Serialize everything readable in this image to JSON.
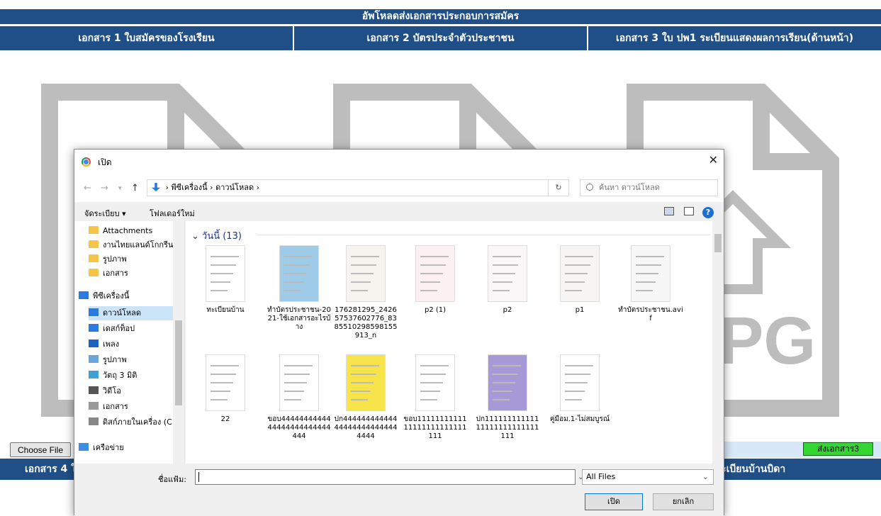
{
  "page": {
    "title": "อัพโหลดส่งเอกสารประกอบการสมัคร",
    "columns": [
      "เอกสาร 1 ใบสมัครของโรงเรียน",
      "เอกสาร 2 บัตรประจำตัวประชาชน",
      "เอกสาร 3 ใบ ปพ1 ระเบียนแสดงผลการเรียน(ด้านหน้า)"
    ],
    "choose_file": "Choose File",
    "send_button": "ส่งเอกสาร3",
    "bottom_left": "เอกสาร 4 ใ",
    "bottom_right": "าทะเบียนบ้านบิดา"
  },
  "dialog": {
    "title": "เปิด",
    "close": "✕",
    "breadcrumb": [
      "พีซีเครื่องนี้",
      "ดาวน์โหลด"
    ],
    "search_placeholder": "ค้นหา ดาวน์โหลด",
    "organize": "จัดระเบียบ ▾",
    "new_folder": "โฟลเดอร์ใหม่",
    "sidebar": [
      {
        "label": "Attachments",
        "icon": "folder-icon"
      },
      {
        "label": "งานไทยแลนด์โกกรีน",
        "icon": "folder-icon"
      },
      {
        "label": "รูปภาพ",
        "icon": "folder-icon"
      },
      {
        "label": "เอกสาร",
        "icon": "folder-icon"
      },
      {
        "label": "พีซีเครื่องนี้",
        "icon": "pc-icon"
      },
      {
        "label": "ดาวน์โหลด",
        "icon": "download-icon"
      },
      {
        "label": "เดสก์ท็อป",
        "icon": "desktop-icon"
      },
      {
        "label": "เพลง",
        "icon": "music-icon"
      },
      {
        "label": "รูปภาพ",
        "icon": "pictures-icon"
      },
      {
        "label": "วัตถุ 3 มิติ",
        "icon": "3d-objects-icon"
      },
      {
        "label": "วิดีโอ",
        "icon": "video-icon"
      },
      {
        "label": "เอกสาร",
        "icon": "documents-icon"
      },
      {
        "label": "ดิสก์ภายในเครื่อง (C",
        "icon": "drive-icon"
      },
      {
        "label": "เครือข่าย",
        "icon": "network-icon"
      }
    ],
    "group_label": "วันนี้ (13)",
    "files": [
      "ทะเบียนบ้าน",
      "ทำบัตรประชาชน-2021-ใช้เอกสารอะไรบ้าง",
      "176281295_242657537602776_8385510298598155913_n",
      "p2 (1)",
      "p2",
      "p1",
      "ทำบัตรประชาชน.avif",
      "22",
      "ขอบ4444444444444444444444444444",
      "ปก444444444444444444444444444444",
      "ขอบ1111111111111111111111111111",
      "ปก11111111111111111111111111111",
      "คู่มือม.1-ไม่สมบูรณ์"
    ],
    "filename_label": "ชื่อแฟ้ม:",
    "filter": "All Files",
    "open": "เปิด",
    "cancel": "ยกเลิก"
  }
}
